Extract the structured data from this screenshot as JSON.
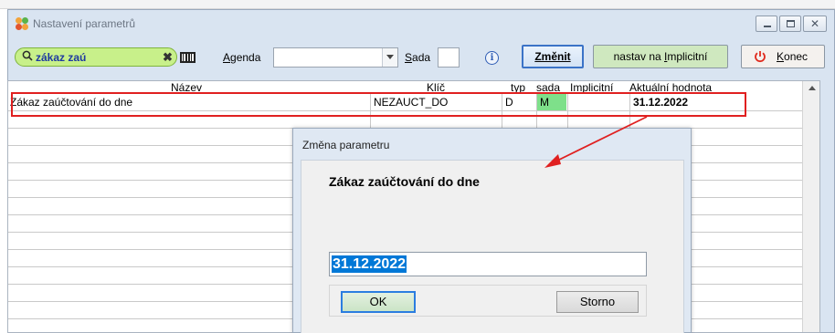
{
  "window": {
    "title": "Nastavení parametrů"
  },
  "toolbar": {
    "search_value": "zákaz zaú",
    "agenda_label_prefix": "",
    "agenda_label_u": "A",
    "agenda_label_rest": "genda",
    "agenda_value": "",
    "sada_label_u": "S",
    "sada_label_rest": "ada",
    "sada_value": "",
    "zmenit_label": "Změnit",
    "nastav_prefix": "nastav na ",
    "nastav_u": "I",
    "nastav_rest": "mplicitní",
    "konec_u": "K",
    "konec_rest": "onec"
  },
  "grid": {
    "columns": {
      "nazev": "Název",
      "klic": "Klíč",
      "typ": "typ",
      "sada": "sada",
      "implicitni": "Implicitní",
      "aktualni": "Aktuální hodnota"
    },
    "rows": [
      {
        "nazev": "Zákaz zaúčtování do dne",
        "klic": "NEZAUCT_DO",
        "typ": "D",
        "sada": "M",
        "implicitni": "",
        "aktualni": "31.12.2022"
      }
    ]
  },
  "dialog": {
    "title": "Změna parametru",
    "label": "Zákaz zaúčtování do dne",
    "value": "31.12.2022",
    "ok_label": "OK",
    "storno_label": "Storno"
  },
  "colors": {
    "search_pill": "#c8f08a",
    "sada_cell": "#7ee08a",
    "highlight": "#e02020",
    "nastav_button": "#cfe8bf",
    "selection": "#0078d7"
  }
}
